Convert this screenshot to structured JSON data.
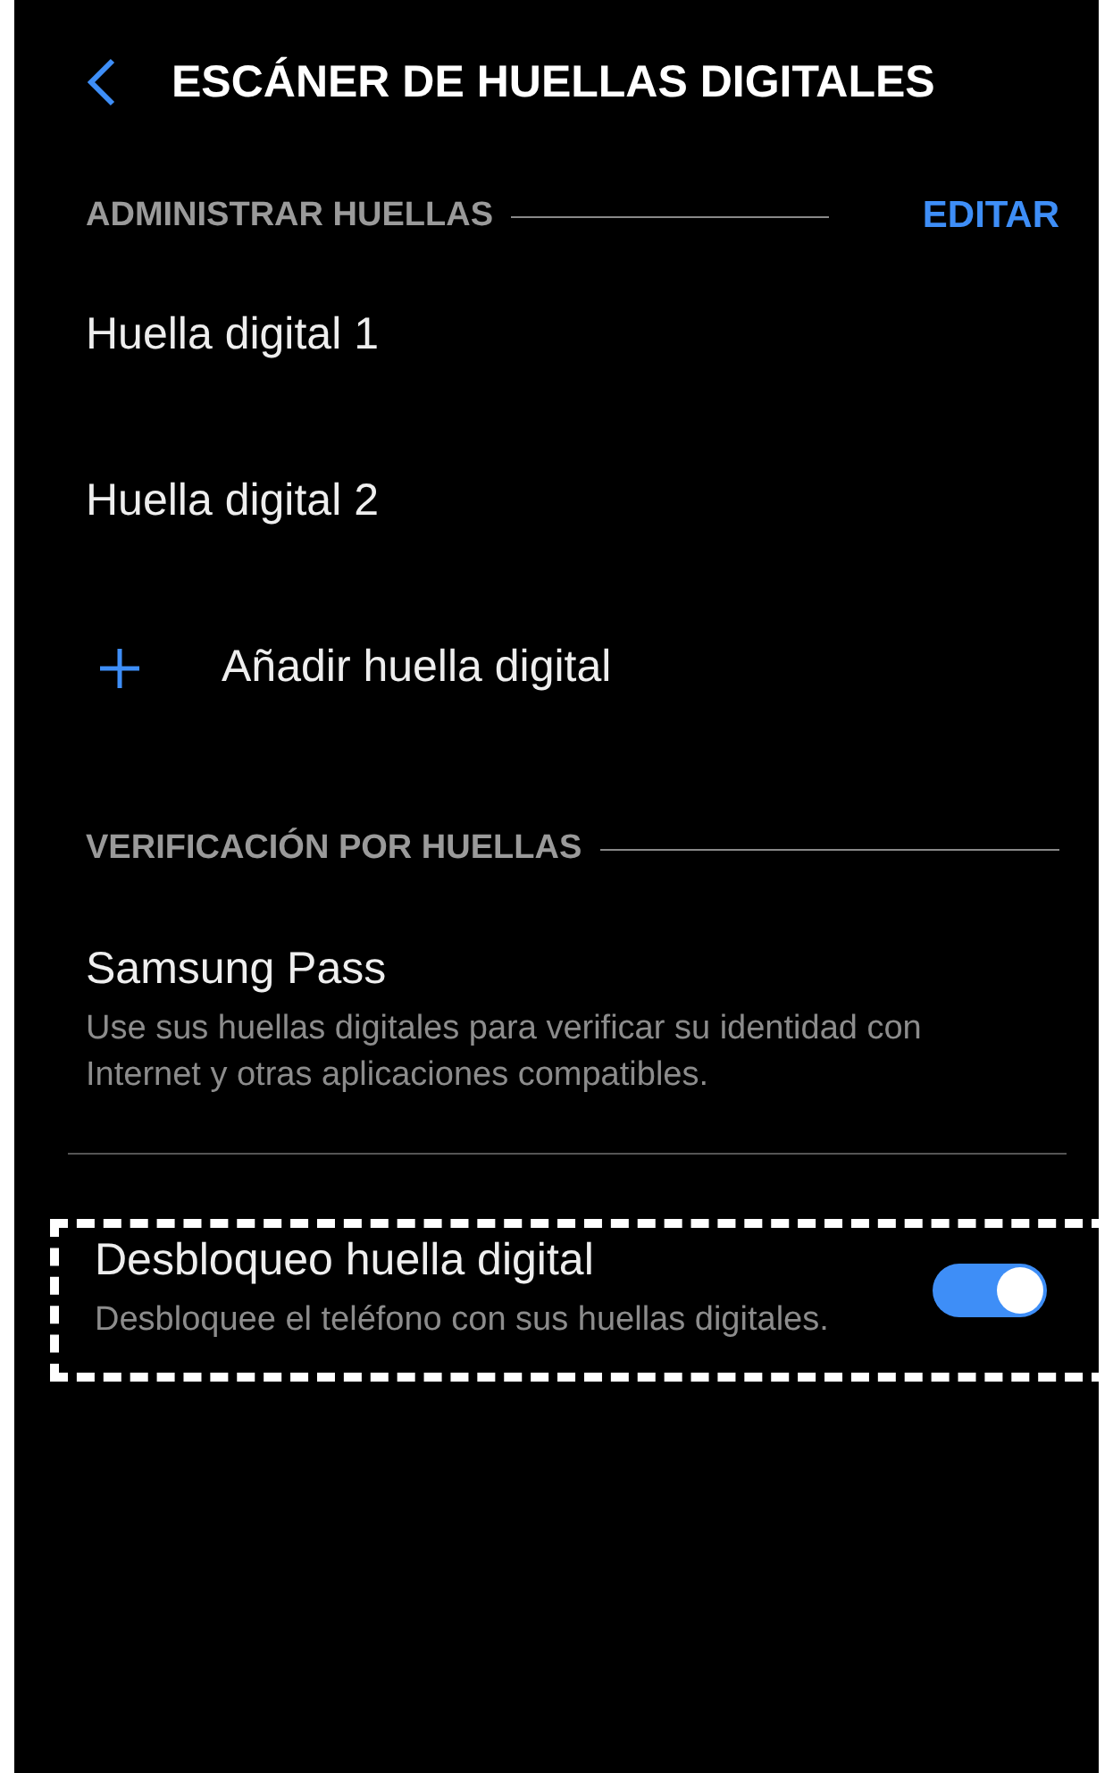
{
  "header": {
    "title": "ESCÁNER DE HUELLAS DIGITALES"
  },
  "sections": [
    {
      "title": "ADMINISTRAR HUELLAS",
      "action": "EDITAR",
      "items": [
        {
          "kind": "item",
          "title": "Huella digital 1"
        },
        {
          "kind": "item",
          "title": "Huella digital 2"
        },
        {
          "kind": "add",
          "title": "Añadir huella digital"
        }
      ]
    },
    {
      "title": "VERIFICACIÓN POR HUELLAS",
      "items": [
        {
          "kind": "detail",
          "title": "Samsung Pass",
          "description": "Use sus huellas digitales para verificar su identidad con Internet y otras aplicaciones compatibles."
        },
        {
          "kind": "switch",
          "title": "Desbloqueo huella digital",
          "description": "Desbloquee el teléfono con sus huellas digitales.",
          "on": true,
          "highlighted": true
        }
      ]
    }
  ]
}
